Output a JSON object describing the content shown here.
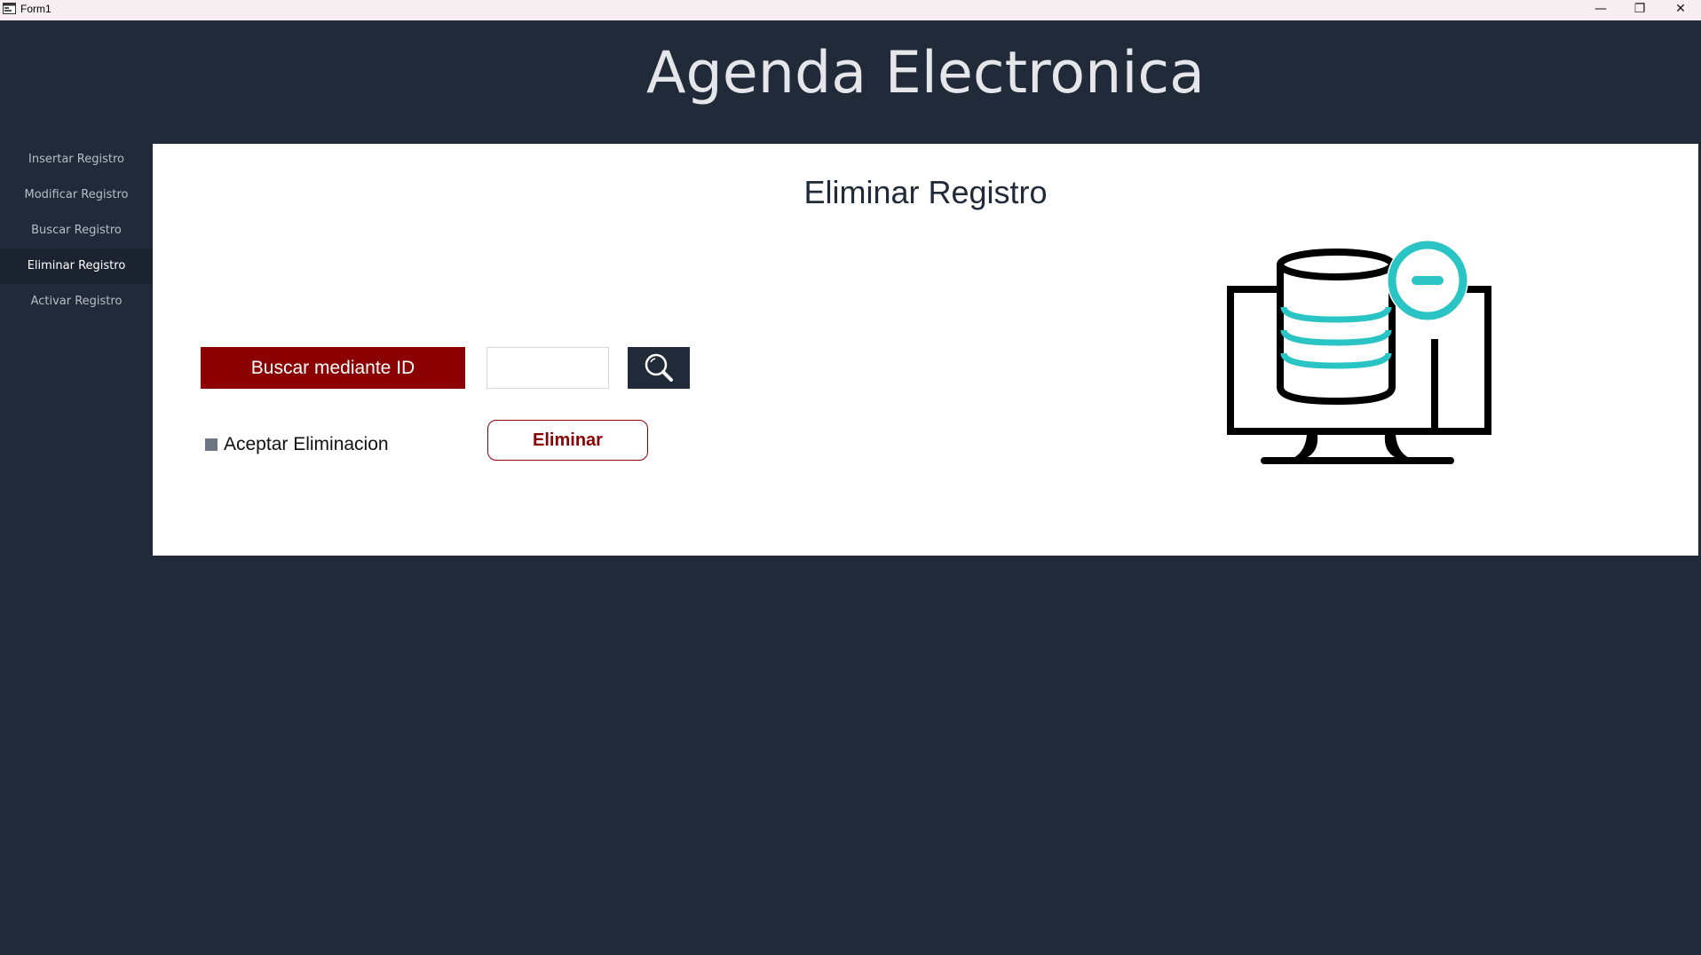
{
  "window": {
    "title": "Form1",
    "minimize": "—",
    "restore": "❐",
    "close": "✕"
  },
  "app": {
    "title": "Agenda Electronica"
  },
  "sidebar": {
    "items": [
      {
        "label": "Insertar Registro"
      },
      {
        "label": "Modificar Registro"
      },
      {
        "label": "Buscar Registro"
      },
      {
        "label": "Eliminar Registro",
        "active": true
      },
      {
        "label": "Activar Registro"
      }
    ]
  },
  "panel": {
    "title": "Eliminar Registro",
    "search_id_label": "Buscar mediante ID",
    "id_value": "",
    "accept_label": "Aceptar Eliminacion",
    "delete_label": "Eliminar"
  },
  "colors": {
    "accent": "#8b0000",
    "dark": "#212a38",
    "illustration_accent": "#2bc4c4"
  },
  "icons": {
    "search": "magnifier-icon",
    "illustration": "database-remove-monitor-icon"
  }
}
